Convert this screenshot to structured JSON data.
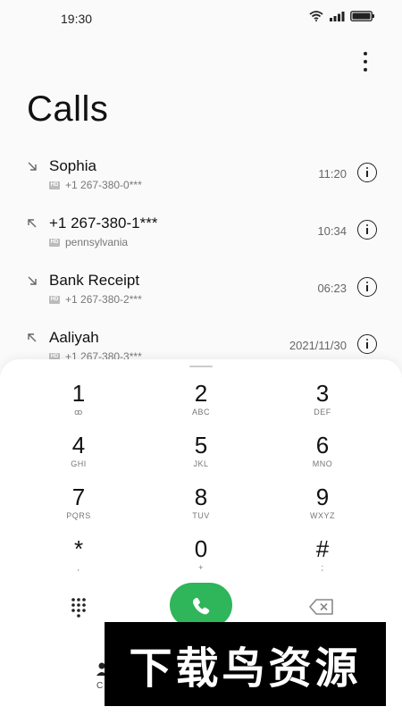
{
  "status_bar": {
    "time": "19:30",
    "icons": [
      "wifi-icon",
      "signal-icon",
      "battery-icon"
    ]
  },
  "header": {
    "title": "Calls",
    "menu_icon": "more-vertical-icon"
  },
  "calls": [
    {
      "name": "Sophia",
      "detail": "+1 267-380-0***",
      "time": "11:20",
      "direction": "incoming"
    },
    {
      "name": "+1 267-380-1***",
      "detail": "pennsylvania",
      "time": "10:34",
      "direction": "outgoing"
    },
    {
      "name": "Bank Receipt",
      "detail": "+1 267-380-2***",
      "time": "06:23",
      "direction": "incoming"
    },
    {
      "name": "Aaliyah",
      "detail": "+1 267-380-3***",
      "time": "2021/11/30",
      "direction": "outgoing"
    }
  ],
  "keypad": [
    [
      {
        "digit": "1",
        "letters": "ꝏ"
      },
      {
        "digit": "2",
        "letters": "ABC"
      },
      {
        "digit": "3",
        "letters": "DEF"
      }
    ],
    [
      {
        "digit": "4",
        "letters": "GHI"
      },
      {
        "digit": "5",
        "letters": "JKL"
      },
      {
        "digit": "6",
        "letters": "MNO"
      }
    ],
    [
      {
        "digit": "7",
        "letters": "PQRS"
      },
      {
        "digit": "8",
        "letters": "TUV"
      },
      {
        "digit": "9",
        "letters": "WXYZ"
      }
    ],
    [
      {
        "digit": "*",
        "letters": ","
      },
      {
        "digit": "0",
        "letters": "+"
      },
      {
        "digit": "#",
        "letters": ";"
      }
    ]
  ],
  "actions": {
    "grid_icon": "dialpad-grid-icon",
    "call_icon": "phone-icon",
    "backspace_icon": "backspace-icon",
    "call_color": "#2fb55a"
  },
  "bottom_partial_label": "C",
  "watermark": "下载鸟资源"
}
